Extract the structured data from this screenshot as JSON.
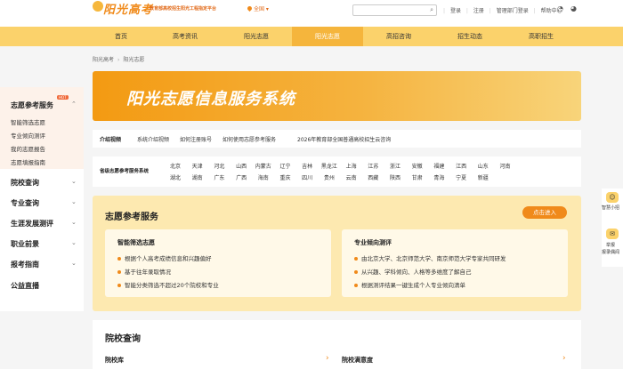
{
  "header": {
    "logo_text": "阳光高考",
    "slogan": "教育部高校招生阳光工程指定平台",
    "region": "全国",
    "search_placeholder": "",
    "links": [
      "登录",
      "注册",
      "管理部门登录",
      "帮助中心"
    ]
  },
  "nav": {
    "items": [
      "首页",
      "高考资讯",
      "阳光志愿",
      "阳光志愿",
      "高招咨询",
      "招生动态",
      "高职招生"
    ]
  },
  "breadcrumb": [
    "阳光高考",
    "阳光志愿"
  ],
  "sidebar": {
    "title": "志愿参考服务",
    "badge": "HOT",
    "subitems": [
      "智能筛选志愿",
      "专业倾向测评",
      "我的志愿报告",
      "志愿填报指南"
    ],
    "categories": [
      "院校查询",
      "专业查询",
      "生涯发展测评",
      "职业前景",
      "报考指南",
      "公益直播"
    ]
  },
  "banner": {
    "title": "阳光志愿信息服务系统"
  },
  "intro": {
    "label": "介绍视频",
    "links": [
      "系统介绍视频",
      "如何注册账号",
      "如何使用志愿参考服务",
      "2026年教育部全国普通高校招生云咨询"
    ]
  },
  "provinces": {
    "label": "省级志愿参考服务系统",
    "row1": [
      "北京",
      "天津",
      "河北",
      "山西",
      "内蒙古",
      "辽宁",
      "吉林",
      "黑龙江",
      "上海",
      "江苏",
      "浙江",
      "安徽",
      "福建",
      "江西",
      "山东",
      "河南"
    ],
    "row2": [
      "湖北",
      "湖南",
      "广东",
      "广西",
      "海南",
      "重庆",
      "四川",
      "贵州",
      "云南",
      "西藏",
      "陕西",
      "甘肃",
      "青海",
      "宁夏",
      "新疆"
    ]
  },
  "service": {
    "title": "志愿参考服务",
    "enter": "点击进入",
    "panels": [
      {
        "title": "智能筛选志愿",
        "items": [
          "根据个人高考成绩信息和兴趣偏好",
          "基于往年录取情况",
          "智能分类筛选不超过20个院校和专业"
        ]
      },
      {
        "title": "专业倾向测评",
        "items": [
          "由北京大学、北京师范大学、南京师范大学专家共同研发",
          "从兴趣、学科倾向、人格等多维度了解自己",
          "根据测评结果一键生成个人专业倾向清单"
        ]
      }
    ]
  },
  "school": {
    "title": "院校查询",
    "links": [
      "院校库",
      "院校满意度"
    ]
  },
  "float": {
    "label1": "智慧小招",
    "label2a": "举报",
    "label2b": "报录偶闻"
  }
}
